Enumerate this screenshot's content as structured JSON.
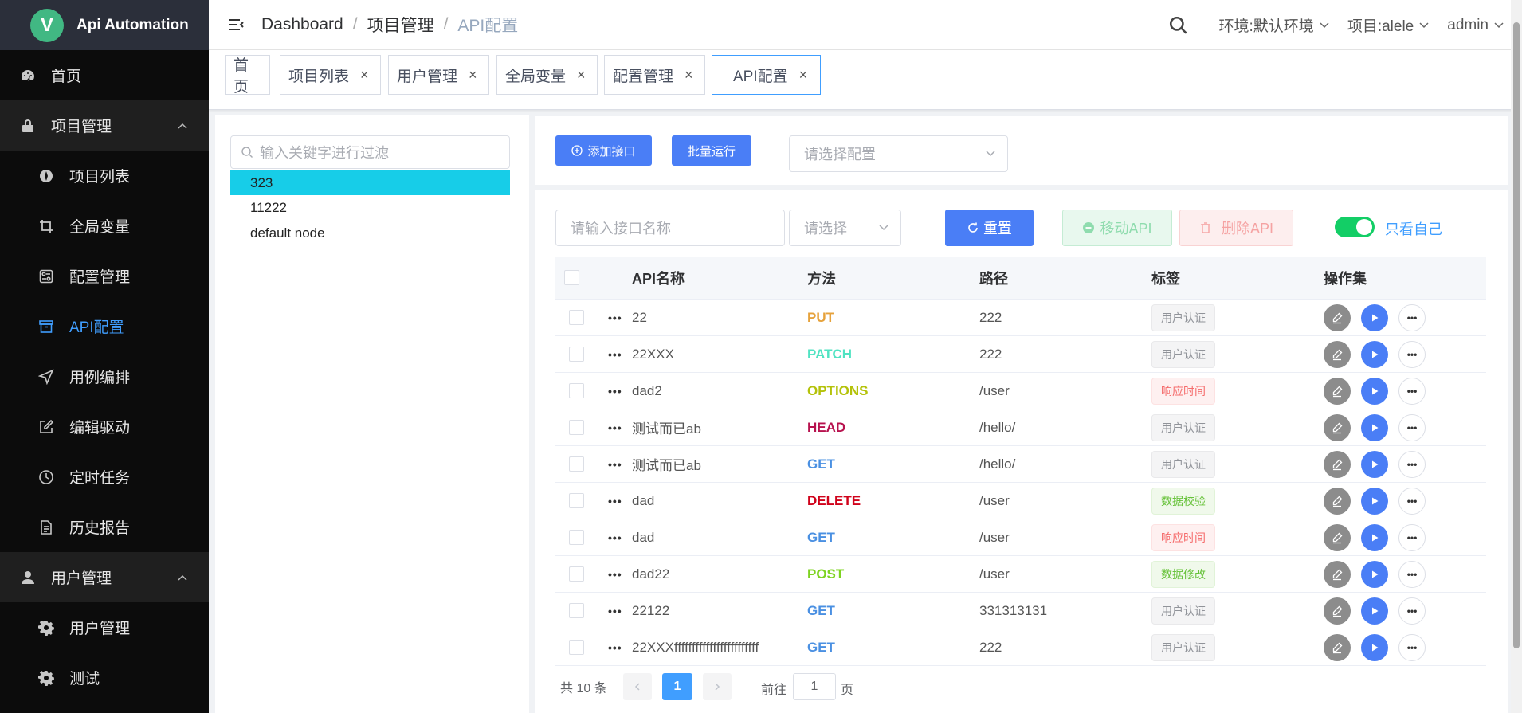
{
  "app": {
    "logo_letter": "V",
    "title": "Api Automation"
  },
  "sidebar": {
    "items": [
      {
        "label": "首页",
        "icon": "dashboard-icon",
        "level": "top"
      },
      {
        "label": "项目管理",
        "icon": "lock-icon",
        "level": "group"
      },
      {
        "label": "项目列表",
        "icon": "project-icon",
        "level": "sub"
      },
      {
        "label": "全局变量",
        "icon": "crop-icon",
        "level": "sub"
      },
      {
        "label": "配置管理",
        "icon": "config-icon",
        "level": "sub"
      },
      {
        "label": "API配置",
        "icon": "box-icon",
        "level": "sub",
        "active": true
      },
      {
        "label": "用例编排",
        "icon": "send-icon",
        "level": "sub"
      },
      {
        "label": "编辑驱动",
        "icon": "edit-icon",
        "level": "sub"
      },
      {
        "label": "定时任务",
        "icon": "clock-icon",
        "level": "sub"
      },
      {
        "label": "历史报告",
        "icon": "document-icon",
        "level": "sub"
      },
      {
        "label": "用户管理",
        "icon": "user-icon",
        "level": "group"
      },
      {
        "label": "用户管理",
        "icon": "gear-icon",
        "level": "sub"
      },
      {
        "label": "测试",
        "icon": "gear-icon",
        "level": "sub"
      }
    ]
  },
  "header": {
    "breadcrumb": [
      "Dashboard",
      "项目管理",
      "API配置"
    ],
    "env": "环境:默认环境",
    "project": "项目:alele",
    "user": "admin"
  },
  "tags": [
    {
      "label": "首页",
      "closable": false
    },
    {
      "label": "项目列表",
      "closable": true
    },
    {
      "label": "用户管理",
      "closable": true
    },
    {
      "label": "全局变量",
      "closable": true
    },
    {
      "label": "配置管理",
      "closable": true
    },
    {
      "label": "API配置",
      "closable": true,
      "active": true
    }
  ],
  "tree": {
    "placeholder": "输入关键字进行过滤",
    "nodes": [
      "323",
      "11222",
      "default node"
    ],
    "selected": "323"
  },
  "toolbar": {
    "add_label": "添加接口",
    "batch_label": "批量运行",
    "config_placeholder": "请选择配置"
  },
  "filters": {
    "name_placeholder": "请输入接口名称",
    "select_placeholder": "请选择",
    "reset_label": "重置",
    "move_label": "移动API",
    "delete_label": "删除API",
    "only_mine_label": "只看自己",
    "only_mine_on": true
  },
  "table": {
    "columns": [
      "API名称",
      "方法",
      "路径",
      "标签",
      "操作集"
    ],
    "rows": [
      {
        "name": "22",
        "method": "PUT",
        "path": "222",
        "tag": "用户认证",
        "tag_type": "info"
      },
      {
        "name": "22XXX",
        "method": "PATCH",
        "path": "222",
        "tag": "用户认证",
        "tag_type": "info"
      },
      {
        "name": "dad2",
        "method": "OPTIONS",
        "path": "/user",
        "tag": "响应时间",
        "tag_type": "danger"
      },
      {
        "name": "测试而已ab",
        "method": "HEAD",
        "path": "/hello/",
        "tag": "用户认证",
        "tag_type": "info"
      },
      {
        "name": "测试而已ab",
        "method": "GET",
        "path": "/hello/",
        "tag": "用户认证",
        "tag_type": "info"
      },
      {
        "name": "dad",
        "method": "DELETE",
        "path": "/user",
        "tag": "数据校验",
        "tag_type": "success"
      },
      {
        "name": "dad",
        "method": "GET",
        "path": "/user",
        "tag": "响应时间",
        "tag_type": "danger"
      },
      {
        "name": "dad22",
        "method": "POST",
        "path": "/user",
        "tag": "数据修改",
        "tag_type": "success"
      },
      {
        "name": "22122",
        "method": "GET",
        "path": "331313131",
        "tag": "用户认证",
        "tag_type": "info"
      },
      {
        "name": "22XXXffffffffffffffffffffffff",
        "method": "GET",
        "path": "222",
        "tag": "用户认证",
        "tag_type": "info"
      }
    ]
  },
  "method_colors": {
    "PUT": "#e6a23c",
    "PATCH": "#50e3c2",
    "OPTIONS": "#b4c20a",
    "HEAD": "#b7124e",
    "GET": "#4a90e2",
    "DELETE": "#d0021b",
    "POST": "#7ed321"
  },
  "pagination": {
    "total_text": "共 10 条",
    "current_page": "1",
    "goto_prefix": "前往",
    "goto_value": "1",
    "goto_suffix": "页"
  },
  "colors": {
    "accent": "#409eff",
    "primary_button": "#4a7ef6",
    "toggle_on": "#13ce66",
    "tree_selected": "#17cde8"
  }
}
